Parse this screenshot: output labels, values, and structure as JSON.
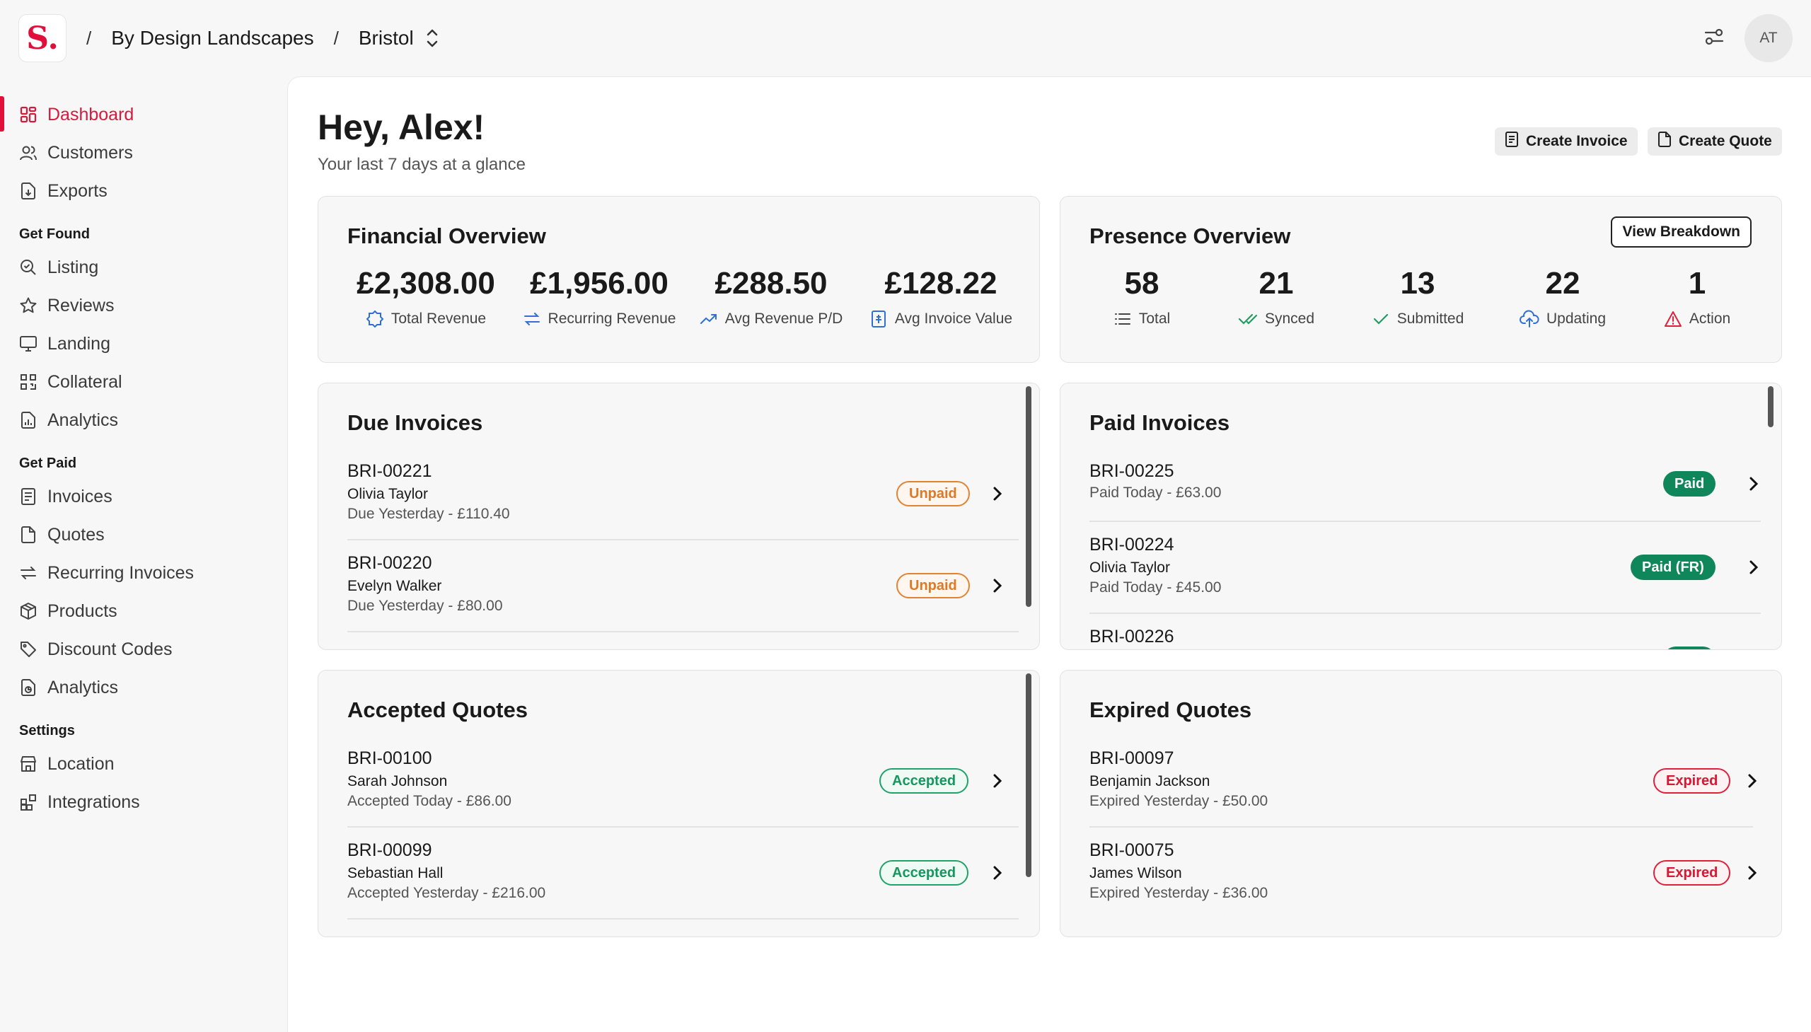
{
  "breadcrumb": {
    "logo": "S.",
    "business": "By Design Landscapes",
    "location": "Bristol"
  },
  "user": {
    "initials": "AT"
  },
  "sidebar": {
    "main": [
      {
        "label": "Dashboard",
        "icon": "dashboard-icon",
        "active": true
      },
      {
        "label": "Customers",
        "icon": "users-icon"
      },
      {
        "label": "Exports",
        "icon": "file-export-icon"
      }
    ],
    "get_found_label": "Get Found",
    "get_found": [
      {
        "label": "Listing",
        "icon": "search-check-icon"
      },
      {
        "label": "Reviews",
        "icon": "star-icon"
      },
      {
        "label": "Landing",
        "icon": "monitor-icon"
      },
      {
        "label": "Collateral",
        "icon": "qr-code-icon"
      },
      {
        "label": "Analytics",
        "icon": "chart-file-icon"
      }
    ],
    "get_paid_label": "Get Paid",
    "get_paid": [
      {
        "label": "Invoices",
        "icon": "invoice-icon"
      },
      {
        "label": "Quotes",
        "icon": "quote-file-icon"
      },
      {
        "label": "Recurring Invoices",
        "icon": "recurring-icon"
      },
      {
        "label": "Products",
        "icon": "package-icon"
      },
      {
        "label": "Discount Codes",
        "icon": "tag-icon"
      },
      {
        "label": "Analytics",
        "icon": "analytics-icon"
      }
    ],
    "settings_label": "Settings",
    "settings": [
      {
        "label": "Location",
        "icon": "store-icon"
      },
      {
        "label": "Integrations",
        "icon": "integrations-icon"
      }
    ]
  },
  "header": {
    "greeting": "Hey, Alex!",
    "subtitle": "Your last 7 days at a glance",
    "create_invoice": "Create Invoice",
    "create_quote": "Create Quote"
  },
  "financial": {
    "title": "Financial Overview",
    "stats": [
      {
        "value": "£2,308.00",
        "label": "Total Revenue"
      },
      {
        "value": "£1,956.00",
        "label": "Recurring Revenue"
      },
      {
        "value": "£288.50",
        "label": "Avg Revenue P/D"
      },
      {
        "value": "£128.22",
        "label": "Avg Invoice Value"
      }
    ]
  },
  "presence": {
    "title": "Presence Overview",
    "button": "View Breakdown",
    "stats": [
      {
        "value": "58",
        "label": "Total"
      },
      {
        "value": "21",
        "label": "Synced"
      },
      {
        "value": "13",
        "label": "Submitted"
      },
      {
        "value": "22",
        "label": "Updating"
      },
      {
        "value": "1",
        "label": "Action"
      }
    ]
  },
  "due_invoices": {
    "title": "Due Invoices",
    "rows": [
      {
        "id": "BRI-00221",
        "name": "Olivia Taylor",
        "sub": "Due Yesterday - £110.40",
        "status": "Unpaid"
      },
      {
        "id": "BRI-00220",
        "name": "Evelyn Walker",
        "sub": "Due Yesterday - £80.00",
        "status": "Unpaid"
      }
    ]
  },
  "paid_invoices": {
    "title": "Paid Invoices",
    "rows": [
      {
        "id": "BRI-00225",
        "sub": "Paid Today - £63.00",
        "status": "Paid"
      },
      {
        "id": "BRI-00224",
        "name": "Olivia Taylor",
        "sub": "Paid Today - £45.00",
        "status": "Paid (FR)"
      },
      {
        "id": "BRI-00226"
      }
    ]
  },
  "accepted_quotes": {
    "title": "Accepted Quotes",
    "rows": [
      {
        "id": "BRI-00100",
        "name": "Sarah Johnson",
        "sub": "Accepted Today - £86.00",
        "status": "Accepted"
      },
      {
        "id": "BRI-00099",
        "name": "Sebastian Hall",
        "sub": "Accepted Yesterday - £216.00",
        "status": "Accepted"
      }
    ]
  },
  "expired_quotes": {
    "title": "Expired Quotes",
    "rows": [
      {
        "id": "BRI-00097",
        "name": "Benjamin Jackson",
        "sub": "Expired Yesterday - £50.00",
        "status": "Expired"
      },
      {
        "id": "BRI-00075",
        "name": "James Wilson",
        "sub": "Expired Yesterday - £36.00",
        "status": "Expired"
      }
    ]
  },
  "colors": {
    "brand": "#e0103a",
    "paid": "#10875a",
    "unpaid": "#e28332",
    "accepted": "#1fa36a",
    "expired": "#e0203a",
    "icon_blue": "#2f6fd6"
  }
}
